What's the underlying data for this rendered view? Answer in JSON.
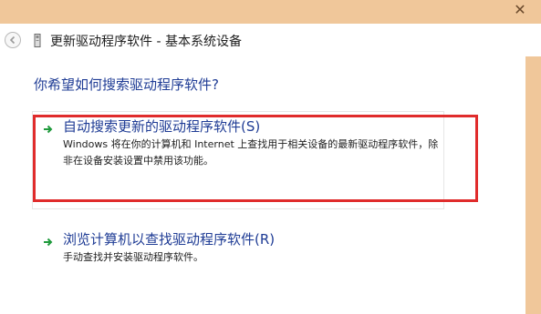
{
  "window": {
    "close_glyph": "✕",
    "header_title": "更新驱动程序软件 - 基本系统设备"
  },
  "content": {
    "question": "你希望如何搜索驱动程序软件?",
    "options": [
      {
        "title": "自动搜索更新的驱动程序软件(S)",
        "description": "Windows 将在你的计算机和 Internet 上查找用于相关设备的最新驱动程序软件，除非在设备安装设置中禁用该功能。"
      },
      {
        "title": "浏览计算机以查找驱动程序软件(R)",
        "description": "手动查找并安装驱动程序软件。"
      }
    ]
  },
  "colors": {
    "chrome": "#f0c79a",
    "link_blue": "#1f3c95",
    "highlight_red": "#e02c2c",
    "arrow_green": "#1f9a3c"
  }
}
